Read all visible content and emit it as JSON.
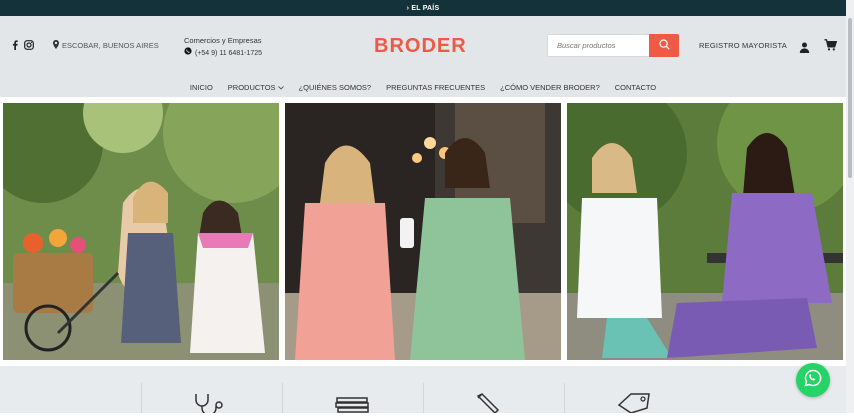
{
  "topbar": {
    "text": "› EL PAÍS"
  },
  "header": {
    "location": "ESCOBAR, BUENOS AIRES",
    "business_title": "Comercios y Empresas",
    "business_phone": "(+54 9) 11 6481-1725",
    "logo": "BRODER",
    "search_placeholder": "Buscar productos",
    "registro": "REGISTRO MAYORISTA"
  },
  "nav": [
    {
      "label": "INICIO"
    },
    {
      "label": "PRODUCTOS"
    },
    {
      "label": "¿QUIÉNES SOMOS?"
    },
    {
      "label": "PREGUNTAS FRECUENTES"
    },
    {
      "label": "¿CÓMO VENDER BRODER?"
    },
    {
      "label": "CONTACTO"
    }
  ],
  "colors": {
    "accent": "#ee5a45",
    "topbar": "#14323a",
    "header_bg": "#e2e6e9",
    "whatsapp": "#25d366"
  },
  "icons": [
    "facebook-icon",
    "instagram-icon",
    "location-pin-icon",
    "whatsapp-icon",
    "search-icon",
    "user-icon",
    "cart-icon",
    "stethoscope-icon",
    "books-icon",
    "pencil-icon",
    "price-tag-icon"
  ]
}
